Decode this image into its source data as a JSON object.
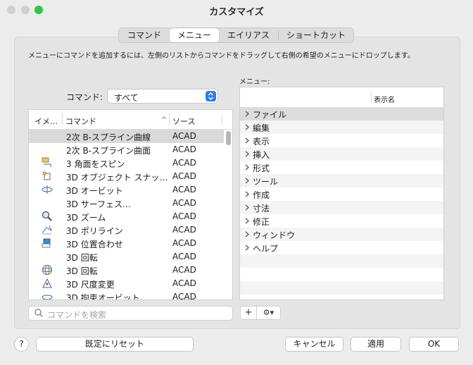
{
  "window": {
    "title": "カスタマイズ"
  },
  "tabs": [
    {
      "label": "コマンド"
    },
    {
      "label": "メニュー"
    },
    {
      "label": "エイリアス"
    },
    {
      "label": "ショートカット"
    }
  ],
  "selected_tab": "メニュー",
  "instruction": "メニューにコマンドを追加するには、左側のリストからコマンドをドラッグして右側の希望のメニューにドロップします。",
  "command_filter": {
    "label": "コマンド:",
    "value": "すべて"
  },
  "command_list": {
    "headers": {
      "image": "イメ…",
      "command": "コマンド",
      "sort_indicator": "^",
      "source": "ソース"
    },
    "rows": [
      {
        "icon": "",
        "name": "2次 B-スプライン曲線",
        "source": "ACAD"
      },
      {
        "icon": "",
        "name": "2次 B-スプライン曲面",
        "source": "ACAD"
      },
      {
        "icon": "spin-face-icon",
        "name": "3 角面をスピン",
        "source": "ACAD"
      },
      {
        "icon": "object-snap-icon",
        "name": "3D オブジェクト スナッ…",
        "source": "ACAD"
      },
      {
        "icon": "orbit-icon",
        "name": "3D オービット",
        "source": "ACAD"
      },
      {
        "icon": "",
        "name": "3D サーフェス…",
        "source": "ACAD"
      },
      {
        "icon": "zoom-icon",
        "name": "3D ズーム",
        "source": "ACAD"
      },
      {
        "icon": "polyline-icon",
        "name": "3D ポリライン",
        "source": "ACAD"
      },
      {
        "icon": "align-icon",
        "name": "3D 位置合わせ",
        "source": "ACAD"
      },
      {
        "icon": "",
        "name": "3D 回転",
        "source": "ACAD"
      },
      {
        "icon": "rotate-gizmo-icon",
        "name": "3D 回転",
        "source": "ACAD"
      },
      {
        "icon": "scale-icon",
        "name": "3D 尺度変更",
        "source": "ACAD"
      },
      {
        "icon": "constrained-orbit-icon",
        "name": "3D 拘束オービット",
        "source": "ACAD"
      }
    ]
  },
  "search": {
    "placeholder": "コマンドを検索"
  },
  "menu_panel": {
    "label": "メニュー:",
    "column_header": "表示名",
    "items": [
      "ファイル",
      "編集",
      "表示",
      "挿入",
      "形式",
      "ツール",
      "作成",
      "寸法",
      "修正",
      "ウィンドウ",
      "ヘルプ"
    ]
  },
  "menu_toolbar": {
    "add": "+",
    "gear": "⚙▾"
  },
  "footer": {
    "help": "?",
    "reset": "既定にリセット",
    "cancel": "キャンセル",
    "apply": "適用",
    "ok": "OK"
  }
}
